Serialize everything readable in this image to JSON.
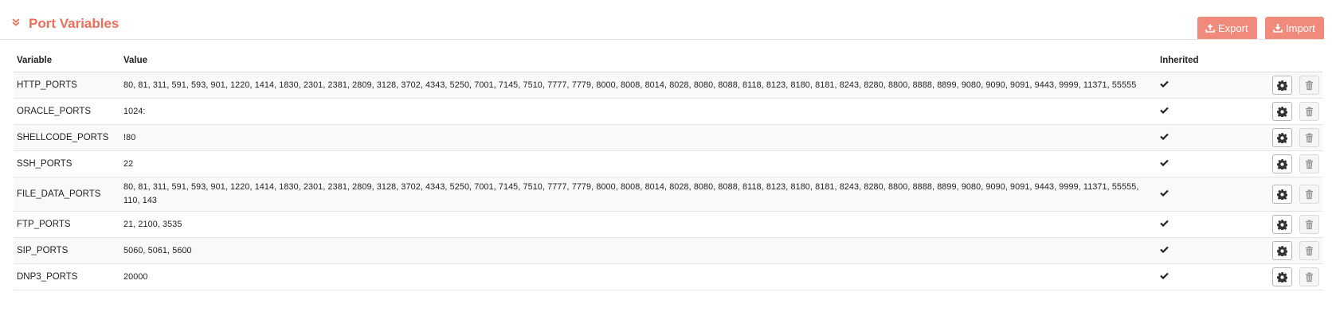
{
  "header": {
    "title": "Port Variables",
    "export_label": "Export",
    "import_label": "Import",
    "toggle_icon": "double-chevron-down-icon",
    "accent_color": "#ec6f5b",
    "button_color": "#f08a7b"
  },
  "table": {
    "columns": [
      "Variable",
      "Value",
      "Inherited"
    ],
    "rows": [
      {
        "variable": "HTTP_PORTS",
        "value": "80, 81, 311, 591, 593, 901, 1220, 1414, 1830, 2301, 2381, 2809, 3128, 3702, 4343, 5250, 7001, 7145, 7510, 7777, 7779, 8000, 8008, 8014, 8028, 8080, 8088, 8118, 8123, 8180, 8181, 8243, 8280, 8800, 8888, 8899, 9080, 9090, 9091, 9443, 9999, 11371, 55555",
        "inherited": true
      },
      {
        "variable": "ORACLE_PORTS",
        "value": "1024:",
        "inherited": true
      },
      {
        "variable": "SHELLCODE_PORTS",
        "value": "!80",
        "inherited": true
      },
      {
        "variable": "SSH_PORTS",
        "value": "22",
        "inherited": true
      },
      {
        "variable": "FILE_DATA_PORTS",
        "value": "80, 81, 311, 591, 593, 901, 1220, 1414, 1830, 2301, 2381, 2809, 3128, 3702, 4343, 5250, 7001, 7145, 7510, 7777, 7779, 8000, 8008, 8014, 8028, 8080, 8088, 8118, 8123, 8180, 8181, 8243, 8280, 8800, 8888, 8899, 9080, 9090, 9091, 9443, 9999, 11371, 55555, 110, 143",
        "inherited": true
      },
      {
        "variable": "FTP_PORTS",
        "value": "21, 2100, 3535",
        "inherited": true
      },
      {
        "variable": "SIP_PORTS",
        "value": "5060, 5061, 5600",
        "inherited": true
      },
      {
        "variable": "DNP3_PORTS",
        "value": "20000",
        "inherited": true
      }
    ]
  }
}
